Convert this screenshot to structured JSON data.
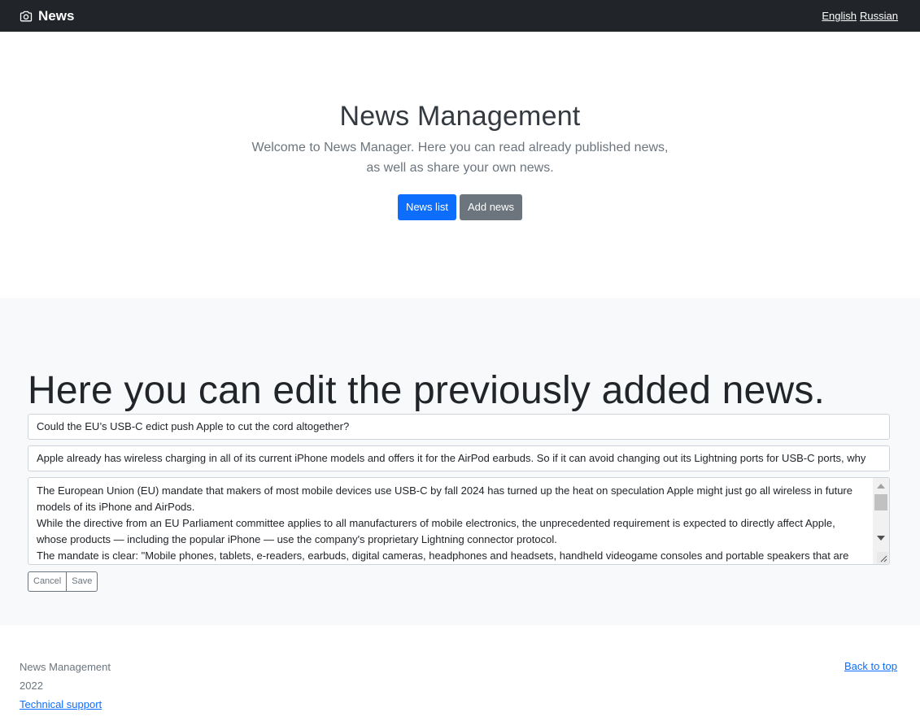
{
  "navbar": {
    "brand": "News",
    "brand_icon": "camera-icon",
    "languages": [
      "English",
      "Russian"
    ]
  },
  "hero": {
    "title": "News Management",
    "lead": "Welcome to News Manager. Here you can read already published news, as well as share your own news.",
    "news_list_label": "News list",
    "add_news_label": "Add news"
  },
  "edit": {
    "heading": "Here you can edit the previously added news.",
    "title_value": "Could the EU’s USB-C edict push Apple to cut the cord altogether?",
    "brief_value": "Apple already has wireless charging in all of its current iPhone models and offers it for the AirPod earbuds. So if it can avoid changing out its Lightning ports for USB-C ports, why",
    "content_lines": [
      "The European Union (EU) mandate that makers of most mobile devices use USB-C by fall 2024 has turned up the heat on speculation Apple might just go all wireless in future models of its iPhone and AirPods.",
      "While the directive from an EU Parliament committee applies to all manufacturers of mobile electronics, the unprecedented requirement is expected to directly affect Apple, whose products — including the popular iPhone — use the company's proprietary Lightning connector protocol.",
      "The mandate is clear: \"Mobile phones, tablets, e-readers, earbuds, digital cameras, headphones and headsets, handheld videogame consoles and portable speakers that are"
    ],
    "cancel_label": "Cancel",
    "save_label": "Save"
  },
  "footer": {
    "app_name": "News Management",
    "year": "2022",
    "support_link": "Technical support",
    "back_to_top": "Back to top"
  },
  "colors": {
    "navbar_bg": "#212529",
    "primary": "#0d6efd",
    "secondary": "#6c757d",
    "section_bg": "#f8f9fa"
  }
}
